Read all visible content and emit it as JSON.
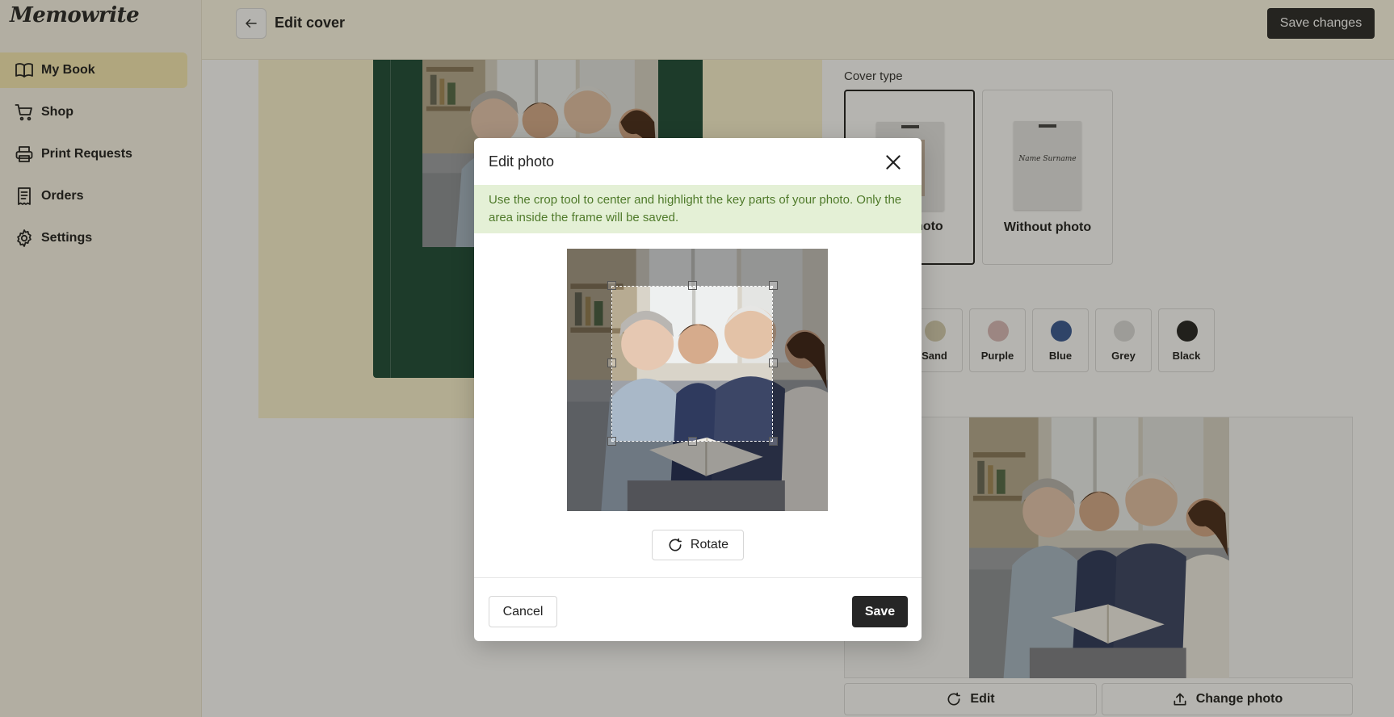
{
  "app": {
    "logo": "Memowrite"
  },
  "sidebar": {
    "items": [
      {
        "label": "My Book",
        "icon": "book-icon",
        "active": true
      },
      {
        "label": "Shop",
        "icon": "cart-icon"
      },
      {
        "label": "Print Requests",
        "icon": "printer-icon"
      },
      {
        "label": "Orders",
        "icon": "receipt-icon"
      },
      {
        "label": "Settings",
        "icon": "gear-icon"
      }
    ]
  },
  "header": {
    "title": "Edit cover",
    "save_label": "Save changes"
  },
  "cover": {
    "type_label": "Cover type",
    "types": [
      {
        "label": "With photo",
        "selected": true
      },
      {
        "label": "Without photo",
        "selected": false,
        "thumb_text": "Name Surname"
      }
    ],
    "colors": [
      {
        "label": "Sand",
        "hex": "#d6cfb3"
      },
      {
        "label": "Purple",
        "hex": "#dbbcbc"
      },
      {
        "label": "Blue",
        "hex": "#3a5a96"
      },
      {
        "label": "Grey",
        "hex": "#dcdcdc"
      },
      {
        "label": "Black",
        "hex": "#262626"
      }
    ],
    "actions": {
      "edit": "Edit",
      "change": "Change photo"
    },
    "book_color": "#1f4d3a"
  },
  "modal": {
    "title": "Edit photo",
    "hint": "Use the crop tool to center and highlight the key parts of your photo. Only the area inside the frame will be saved.",
    "rotate": "Rotate",
    "cancel": "Cancel",
    "save": "Save"
  },
  "colors": {
    "accent": "#f8eab6",
    "hint_bg": "#e4f0d6",
    "hint_text": "#4f7a2a",
    "primary_button": "#262626"
  }
}
